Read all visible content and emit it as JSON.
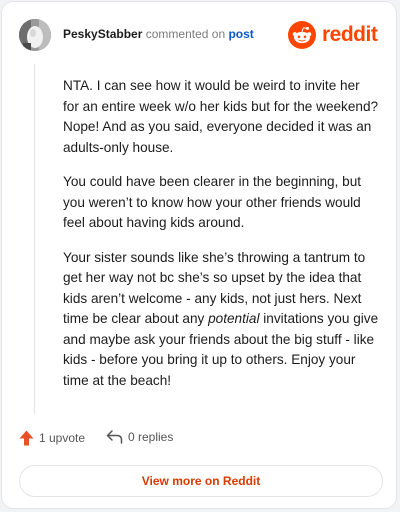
{
  "header": {
    "username": "PeskyStabber",
    "action_text": "commented on",
    "post_link": "post",
    "brand_word": "reddit"
  },
  "comment": {
    "paragraphs": [
      {
        "text": "NTA. I can see how it would be weird to invite her for an entire week w/o her kids but for the weekend? Nope! And as you said, everyone decided it was an adults-only house."
      },
      {
        "text": "You could have been clearer in the beginning, but you weren’t to know how your other friends would feel about having kids around."
      },
      {
        "before": "Your sister sounds like she’s throwing a tantrum to get her way not bc she’s so upset by the idea that kids aren’t welcome - any kids, not just hers. Next time be clear about any ",
        "emphasis": "potential",
        "after": " invitations you give and maybe ask your friends about the big stuff - like kids - before you bring it up to others. Enjoy your time at the beach!"
      }
    ]
  },
  "actions": {
    "upvote_label": "1 upvote",
    "replies_label": "0 replies"
  },
  "footer": {
    "view_more_label": "View more on Reddit"
  },
  "colors": {
    "brand": "#ff4500",
    "link": "#0a58ca",
    "button_text": "#d93a00"
  },
  "icons": {
    "upvote": "upvote-arrow-icon",
    "reply": "reply-arrow-icon",
    "brand": "reddit-snoo-icon"
  }
}
